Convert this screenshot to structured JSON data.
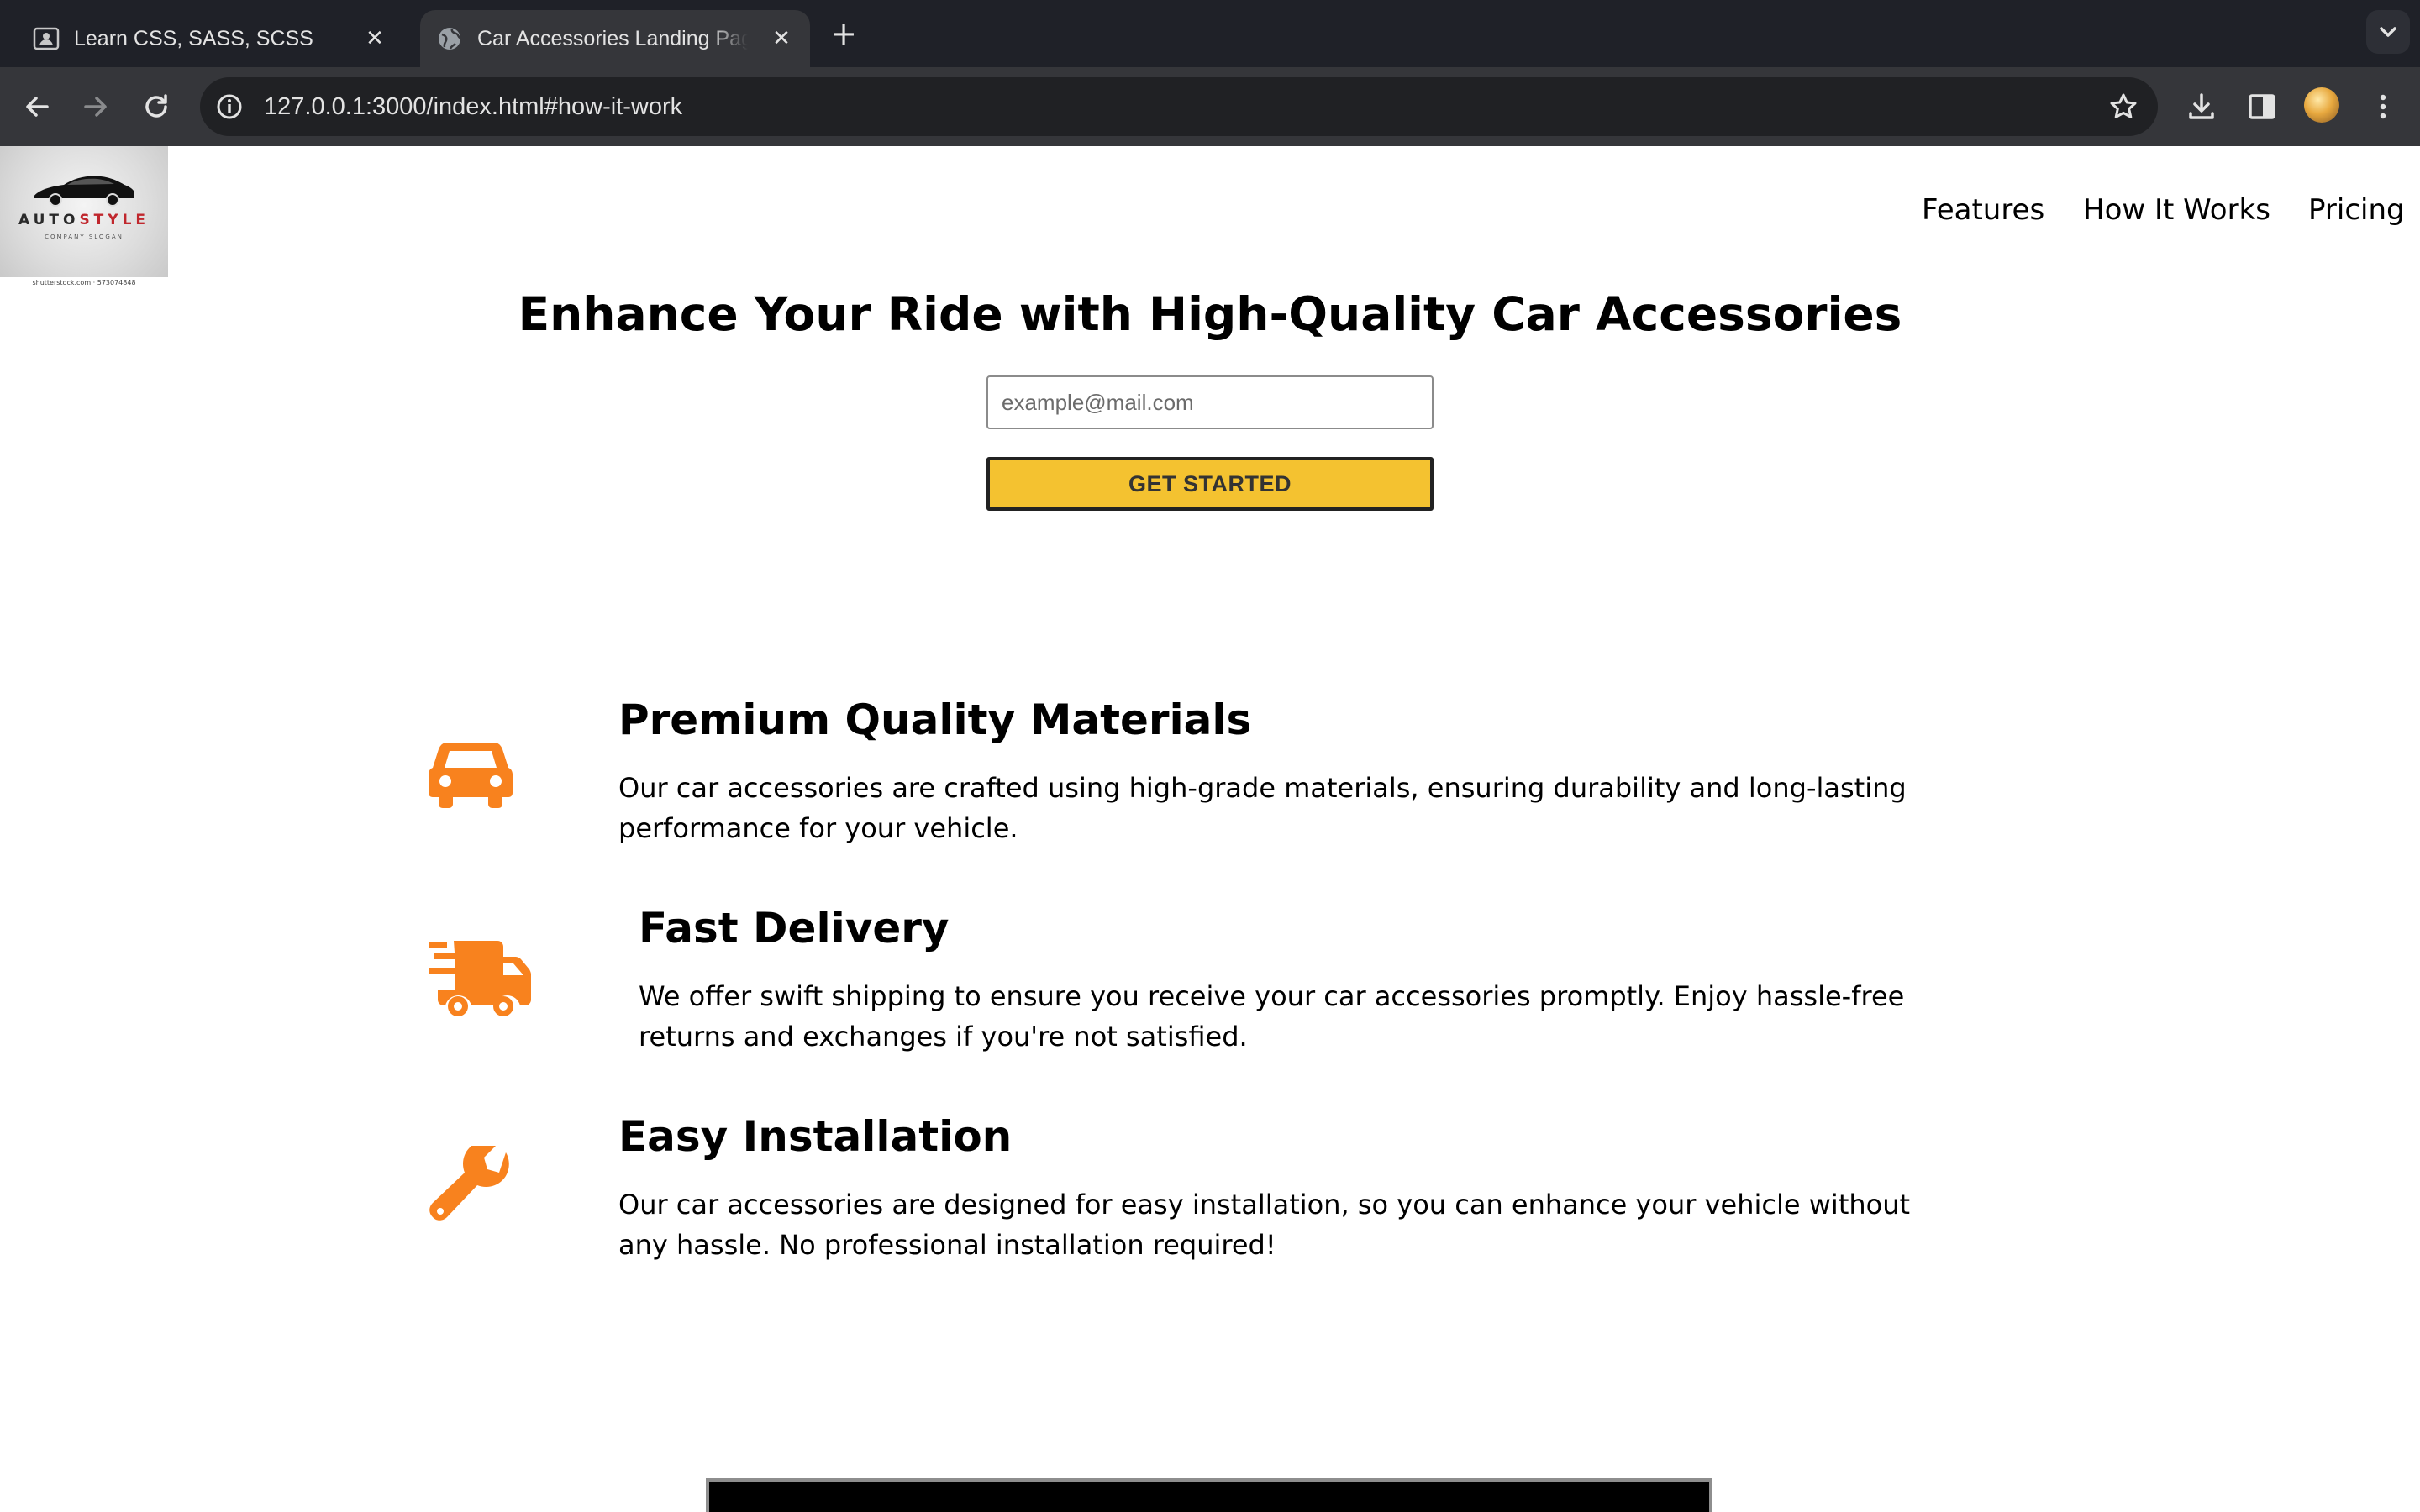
{
  "browser": {
    "tabs": [
      {
        "title": "Learn CSS, SASS, SCSS",
        "active": false
      },
      {
        "title": "Car Accessories Landing Page",
        "active": true
      }
    ],
    "url": "127.0.0.1:3000/index.html#how-it-work"
  },
  "logo": {
    "brand_left": "AUTO",
    "brand_right": "STYLE",
    "tagline": "COMPANY SLOGAN",
    "credit": "shutterstock.com · 573074848"
  },
  "nav": {
    "items": [
      "Features",
      "How It Works",
      "Pricing"
    ]
  },
  "hero": {
    "title": "Enhance Your Ride with High-Quality Car Accessories",
    "email_placeholder": "example@mail.com",
    "cta_label": "GET STARTED"
  },
  "features": [
    {
      "icon": "car-icon",
      "title": "Premium Quality Materials",
      "description": "Our car accessories are crafted using high-grade materials, ensuring durability and long-lasting performance for your vehicle."
    },
    {
      "icon": "delivery-truck-icon",
      "title": "Fast Delivery",
      "description": "We offer swift shipping to ensure you receive your car accessories promptly. Enjoy hassle-free returns and exchanges if you're not satisfied."
    },
    {
      "icon": "wrench-icon",
      "title": "Easy Installation",
      "description": "Our car accessories are designed for easy installation, so you can enhance your vehicle without any hassle. No professional installation required!"
    }
  ],
  "colors": {
    "accent_orange": "#f8821e",
    "cta_yellow": "#f4c230",
    "chrome_dark": "#1f2128",
    "chrome_toolbar": "#35363a"
  }
}
